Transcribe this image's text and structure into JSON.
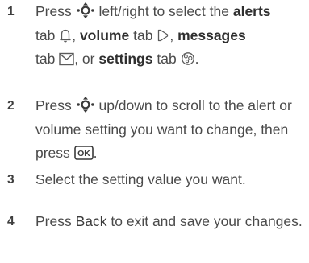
{
  "steps": [
    {
      "number": "1",
      "text": {
        "p1": "Press",
        "p2": "left/right to select the",
        "alerts": "alerts",
        "tab1": "tab",
        "volume": "volume",
        "tab2": "tab",
        "messages": "messages",
        "tab3": "tab",
        "or": ", or",
        "settings": "settings",
        "tab4": "tab",
        "comma1": ",",
        "comma2": ",",
        "period": "."
      }
    },
    {
      "number": "2",
      "text": {
        "p1": "Press",
        "p2": "up/down to scroll to the alert or volume setting you want to change, then press",
        "period": "."
      }
    },
    {
      "number": "3",
      "text": {
        "p1": "Select the setting value you want."
      }
    },
    {
      "number": "4",
      "text": {
        "p1": "Press",
        "back": "Back",
        "p2": "to exit and save your changes."
      }
    }
  ],
  "icons": {
    "nav": "navigation-key-icon",
    "alerts": "bell-icon",
    "volume": "speaker-icon",
    "messages": "envelope-icon",
    "settings": "settings-icon",
    "ok": "ok-key-icon"
  },
  "ok_key_label": "OK"
}
